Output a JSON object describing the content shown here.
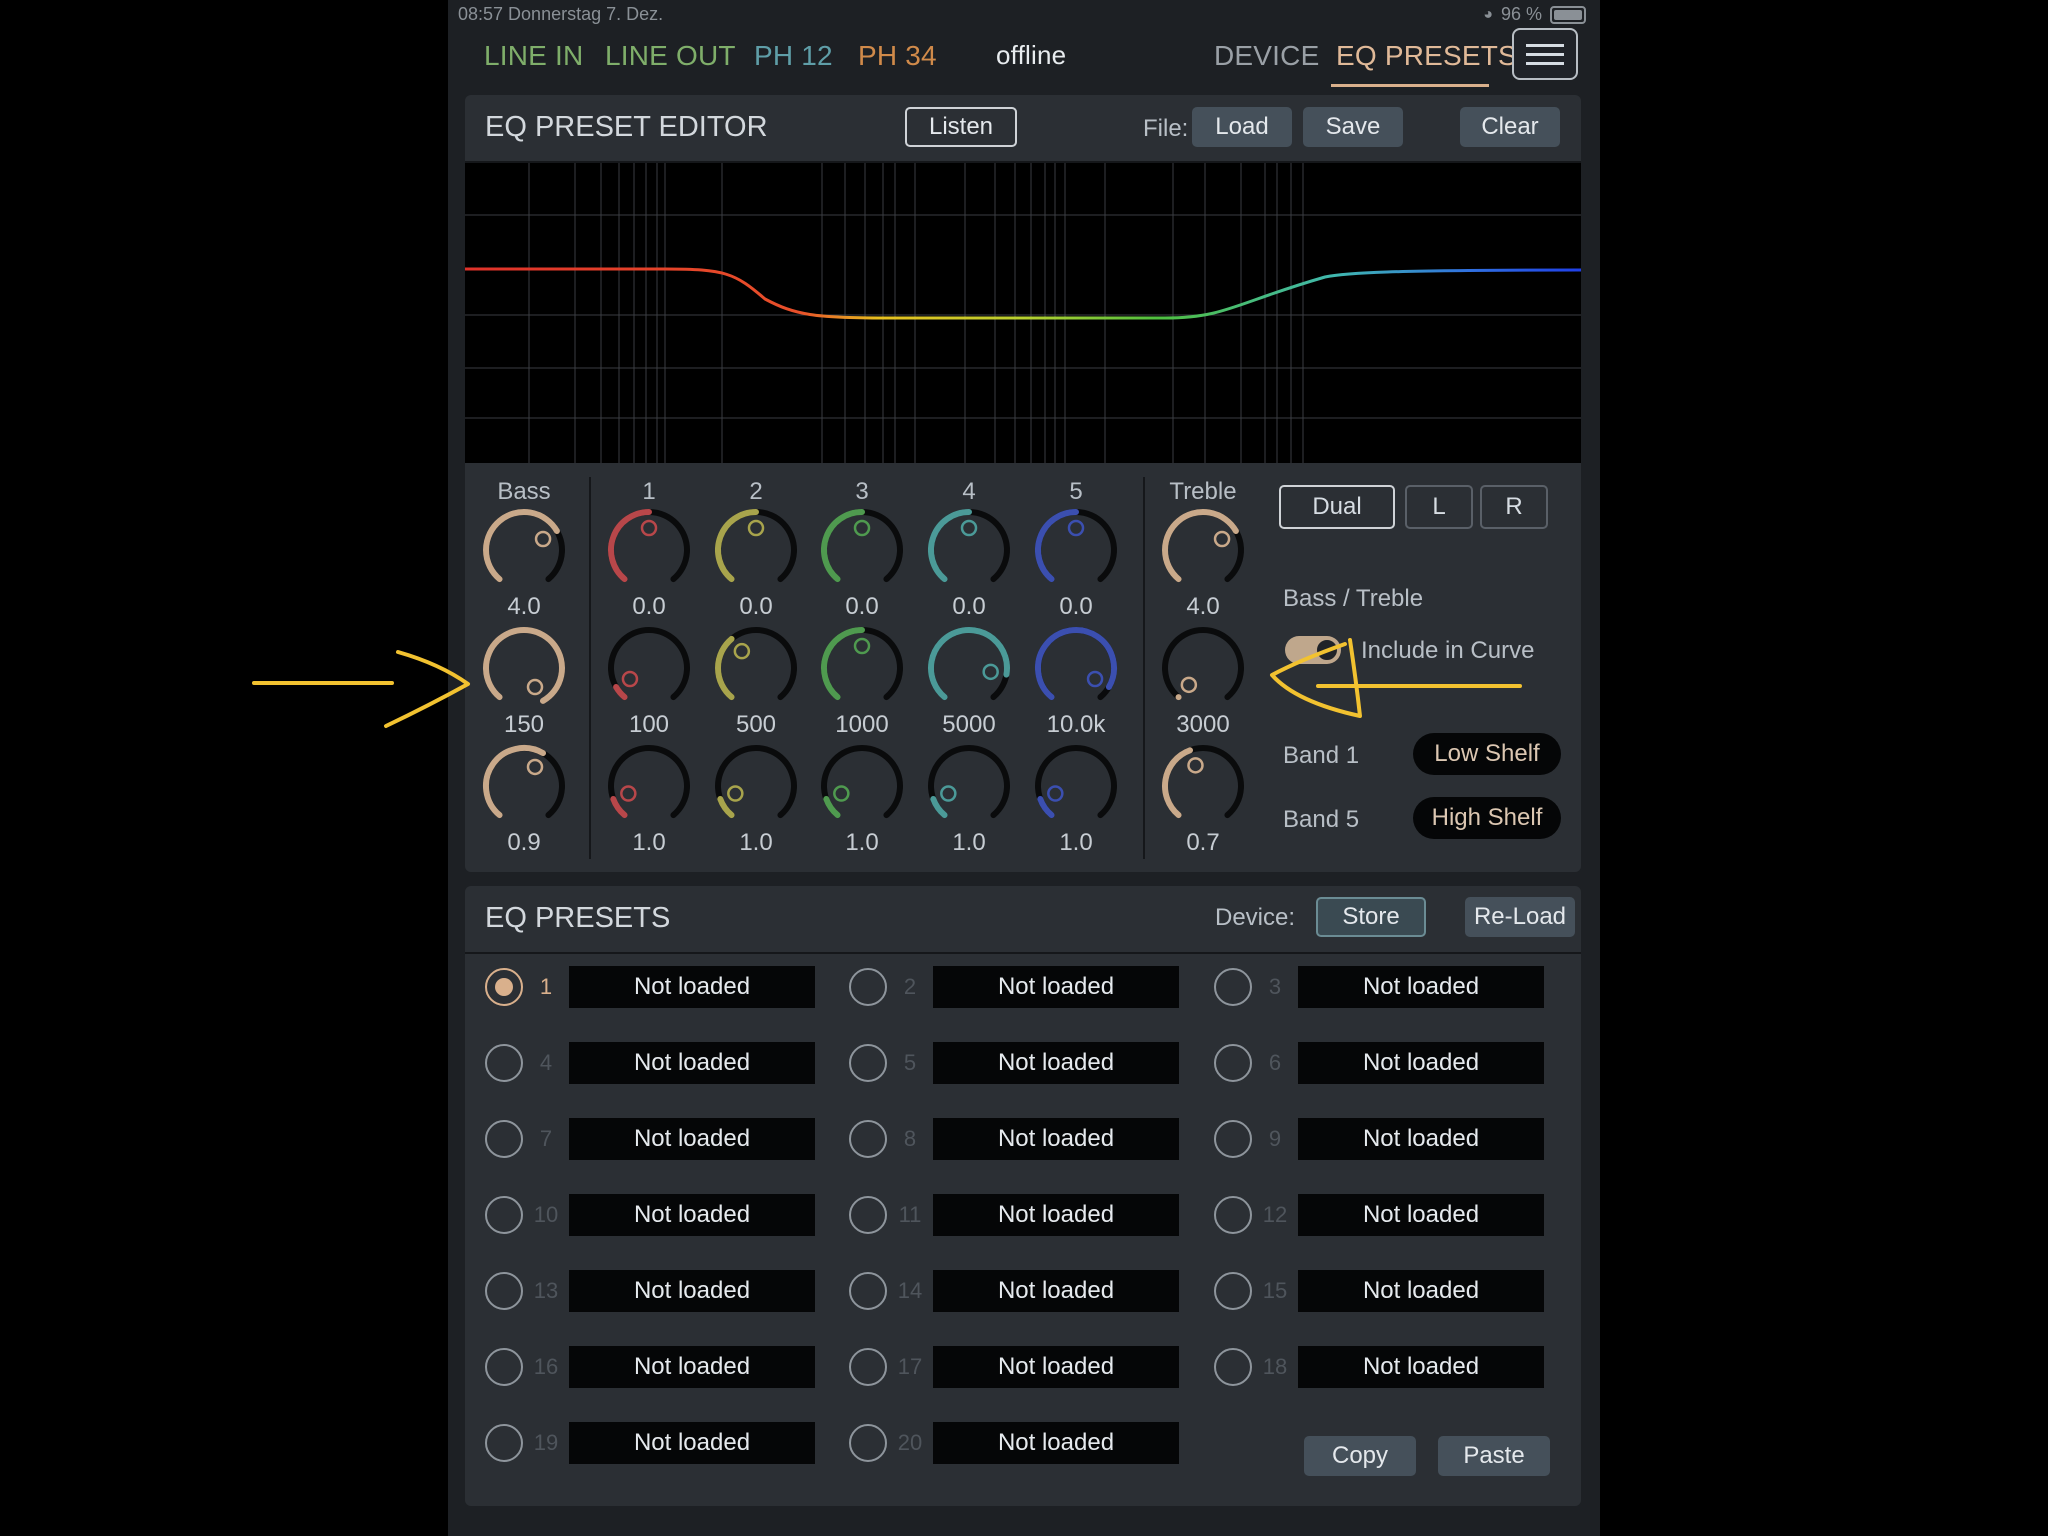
{
  "status_bar": {
    "time_date": "08:57   Donnerstag 7. Dez.",
    "battery": "96 %"
  },
  "nav": {
    "tabs": [
      {
        "label": "LINE IN"
      },
      {
        "label": "LINE OUT"
      },
      {
        "label": "PH 12"
      },
      {
        "label": "PH 34"
      }
    ],
    "connection_status": "offline",
    "right_tabs": [
      {
        "label": "DEVICE"
      },
      {
        "label": "EQ PRESETS"
      }
    ],
    "active_tab": "EQ PRESETS"
  },
  "editor": {
    "title": "EQ PRESET EDITOR",
    "listen_label": "Listen",
    "file_label": "File:",
    "load_label": "Load",
    "save_label": "Save",
    "clear_label": "Clear",
    "bass": {
      "label": "Bass",
      "gain": "4.0",
      "freq": "150",
      "q": "0.9"
    },
    "bands": [
      {
        "label": "1",
        "gain": "0.0",
        "freq": "100",
        "q": "1.0",
        "color": "#b8474a"
      },
      {
        "label": "2",
        "gain": "0.0",
        "freq": "500",
        "q": "1.0",
        "color": "#a8a44c"
      },
      {
        "label": "3",
        "gain": "0.0",
        "freq": "1000",
        "q": "1.0",
        "color": "#4f9a4f"
      },
      {
        "label": "4",
        "gain": "0.0",
        "freq": "5000",
        "q": "1.0",
        "color": "#4b9a98"
      },
      {
        "label": "5",
        "gain": "0.0",
        "freq": "10.0k",
        "q": "1.0",
        "color": "#3b4fb0"
      }
    ],
    "treble": {
      "label": "Treble",
      "gain": "4.0",
      "freq": "3000",
      "q": "0.7"
    },
    "channel_modes": [
      {
        "label": "Dual"
      },
      {
        "label": "L"
      },
      {
        "label": "R"
      }
    ],
    "active_mode": "Dual",
    "bass_treble_label": "Bass / Treble",
    "include_in_curve_label": "Include in Curve",
    "include_in_curve": true,
    "band1_label": "Band 1",
    "band1_type": "Low Shelf",
    "band5_label": "Band 5",
    "band5_type": "High Shelf"
  },
  "presets": {
    "title": "EQ PRESETS",
    "device_label": "Device:",
    "store_label": "Store",
    "reload_label": "Re-Load",
    "selected": 1,
    "items": [
      {
        "num": "1",
        "name": "Not loaded"
      },
      {
        "num": "2",
        "name": "Not loaded"
      },
      {
        "num": "3",
        "name": "Not loaded"
      },
      {
        "num": "4",
        "name": "Not loaded"
      },
      {
        "num": "5",
        "name": "Not loaded"
      },
      {
        "num": "6",
        "name": "Not loaded"
      },
      {
        "num": "7",
        "name": "Not loaded"
      },
      {
        "num": "8",
        "name": "Not loaded"
      },
      {
        "num": "9",
        "name": "Not loaded"
      },
      {
        "num": "10",
        "name": "Not loaded"
      },
      {
        "num": "11",
        "name": "Not loaded"
      },
      {
        "num": "12",
        "name": "Not loaded"
      },
      {
        "num": "13",
        "name": "Not loaded"
      },
      {
        "num": "14",
        "name": "Not loaded"
      },
      {
        "num": "15",
        "name": "Not loaded"
      },
      {
        "num": "16",
        "name": "Not loaded"
      },
      {
        "num": "17",
        "name": "Not loaded"
      },
      {
        "num": "18",
        "name": "Not loaded"
      },
      {
        "num": "19",
        "name": "Not loaded"
      },
      {
        "num": "20",
        "name": "Not loaded"
      }
    ],
    "copy_label": "Copy",
    "paste_label": "Paste"
  },
  "colors": {
    "bass_treble": "#c9a98a",
    "accent": "#d9b08c",
    "annotation": "#f2c230"
  }
}
